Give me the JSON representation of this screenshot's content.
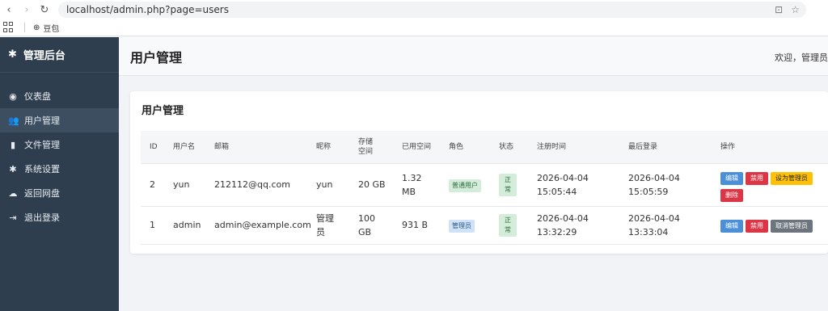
{
  "browser": {
    "url": "localhost/admin.php?page=users",
    "bookmark": "豆包"
  },
  "sidebar": {
    "brand": "管理后台",
    "items": [
      {
        "label": "仪表盘",
        "icon": "dashboard-icon",
        "glyph": "◉"
      },
      {
        "label": "用户管理",
        "icon": "users-icon",
        "glyph": "👥"
      },
      {
        "label": "文件管理",
        "icon": "file-icon",
        "glyph": "▮"
      },
      {
        "label": "系统设置",
        "icon": "gear-icon",
        "glyph": "✱"
      },
      {
        "label": "返回网盘",
        "icon": "cloud-icon",
        "glyph": "☁"
      },
      {
        "label": "退出登录",
        "icon": "logout-icon",
        "glyph": "⇥"
      }
    ]
  },
  "header": {
    "title": "用户管理",
    "welcome": "欢迎，管理员"
  },
  "card": {
    "title": "用户管理",
    "columns": [
      "ID",
      "用户名",
      "邮箱",
      "昵称",
      "存储空间",
      "已用空间",
      "角色",
      "状态",
      "注册时间",
      "最后登录",
      "操作"
    ],
    "rows": [
      {
        "id": "2",
        "username": "yun",
        "email": "212112@qq.com",
        "nickname": "yun",
        "storage": "20 GB",
        "used": "1.32 MB",
        "role": "普通用户",
        "status": "正常",
        "registered": "2026-04-04 15:05:44",
        "last_login": "2026-04-04 15:05:59",
        "actions": [
          "编辑",
          "禁用",
          "设为管理员",
          "删除"
        ]
      },
      {
        "id": "1",
        "username": "admin",
        "email": "admin@example.com",
        "nickname": "管理员",
        "storage": "100 GB",
        "used": "931 B",
        "role": "管理员",
        "status": "正常",
        "registered": "2026-04-04 13:32:29",
        "last_login": "2026-04-04 13:33:04",
        "actions": [
          "编辑",
          "禁用",
          "取消管理员"
        ]
      }
    ]
  },
  "colors": {
    "sidebar_bg": "#2f3e4e",
    "edit": "#4a8fd8",
    "danger": "#dc3545",
    "warning": "#ffc107",
    "secondary": "#6c757d"
  }
}
